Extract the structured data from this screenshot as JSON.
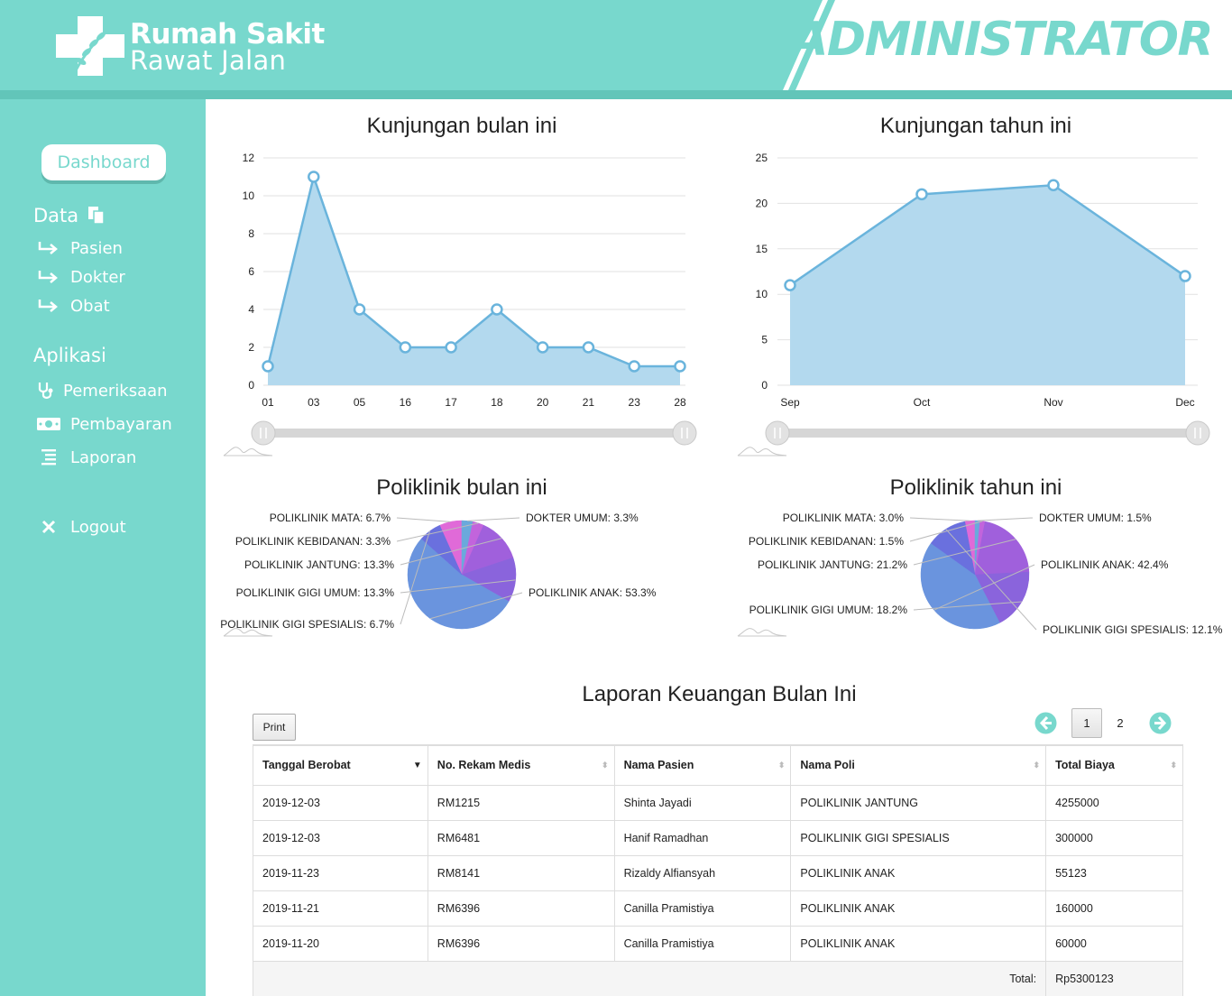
{
  "header": {
    "brand_line1": "Rumah Sakit",
    "brand_line2": "Rawat Jalan",
    "role_title": "ADMINISTRATOR",
    "colors": {
      "primary": "#78d8cd",
      "strip": "#62c5b9"
    }
  },
  "sidebar": {
    "dashboard_label": "Dashboard",
    "data_heading": "Data",
    "data_items": [
      {
        "label": "Pasien",
        "icon": "arrow-return-icon"
      },
      {
        "label": "Dokter",
        "icon": "arrow-return-icon"
      },
      {
        "label": "Obat",
        "icon": "arrow-return-icon"
      }
    ],
    "app_heading": "Aplikasi",
    "app_items": [
      {
        "label": "Pemeriksaan",
        "icon": "stethoscope-icon"
      },
      {
        "label": "Pembayaran",
        "icon": "money-icon"
      },
      {
        "label": "Laporan",
        "icon": "list-icon"
      }
    ],
    "logout_label": "Logout"
  },
  "charts": {
    "month_title": "Kunjungan bulan ini",
    "year_title": "Kunjungan tahun ini",
    "poli_month_title": "Poliklinik bulan ini",
    "poli_year_title": "Poliklinik tahun ini"
  },
  "chart_data": [
    {
      "type": "area",
      "title": "Kunjungan bulan ini",
      "x": [
        "01",
        "03",
        "05",
        "16",
        "17",
        "18",
        "20",
        "21",
        "23",
        "28"
      ],
      "values": [
        1,
        11,
        4,
        2,
        2,
        4,
        2,
        2,
        1,
        1
      ],
      "yticks": [
        "0",
        "2",
        "4",
        "6",
        "8",
        "10",
        "12"
      ],
      "ylim": [
        0,
        12
      ],
      "color": "#6ab4dc",
      "fill": "#b3d9ee"
    },
    {
      "type": "area",
      "title": "Kunjungan tahun ini",
      "x": [
        "Sep",
        "Oct",
        "Nov",
        "Dec"
      ],
      "values": [
        11,
        21,
        22,
        12
      ],
      "yticks": [
        "0",
        "5",
        "10",
        "15",
        "20",
        "25"
      ],
      "ylim": [
        0,
        25
      ],
      "color": "#6ab4dc",
      "fill": "#b3d9ee"
    },
    {
      "type": "pie",
      "title": "Poliklinik bulan ini",
      "slices": [
        {
          "label": "POLIKLINIK MATA: 6.7%",
          "value": 6.7,
          "color": "#e06ad8"
        },
        {
          "label": "DOKTER UMUM: 3.3%",
          "value": 3.3,
          "color": "#6aa9dc"
        },
        {
          "label": "POLIKLINIK KEBIDANAN: 3.3%",
          "value": 3.3,
          "color": "#c264dc"
        },
        {
          "label": "POLIKLINIK JANTUNG: 13.3%",
          "value": 13.3,
          "color": "#a060dc"
        },
        {
          "label": "POLIKLINIK GIGI UMUM: 13.3%",
          "value": 13.3,
          "color": "#8a64dc"
        },
        {
          "label": "POLIKLINIK ANAK: 53.3%",
          "value": 53.3,
          "color": "#6a94de"
        },
        {
          "label": "POLIKLINIK GIGI SPESIALIS: 6.7%",
          "value": 6.7,
          "color": "#6a70de"
        }
      ]
    },
    {
      "type": "pie",
      "title": "Poliklinik tahun ini",
      "slices": [
        {
          "label": "POLIKLINIK MATA: 3.0%",
          "value": 3.0,
          "color": "#e06ad8"
        },
        {
          "label": "DOKTER UMUM: 1.5%",
          "value": 1.5,
          "color": "#6aa9dc"
        },
        {
          "label": "POLIKLINIK KEBIDANAN: 1.5%",
          "value": 1.5,
          "color": "#c264dc"
        },
        {
          "label": "POLIKLINIK JANTUNG: 21.2%",
          "value": 21.2,
          "color": "#a060dc"
        },
        {
          "label": "POLIKLINIK GIGI UMUM: 18.2%",
          "value": 18.2,
          "color": "#8a64dc"
        },
        {
          "label": "POLIKLINIK ANAK: 42.4%",
          "value": 42.4,
          "color": "#6a94de"
        },
        {
          "label": "POLIKLINIK GIGI SPESIALIS: 12.1%",
          "value": 12.1,
          "color": "#6a70de"
        }
      ]
    }
  ],
  "report": {
    "title": "Laporan Keuangan Bulan Ini",
    "print_label": "Print",
    "page1": "1",
    "page2": "2",
    "columns": [
      "Tanggal Berobat",
      "No. Rekam Medis",
      "Nama Pasien",
      "Nama Poli",
      "Total Biaya"
    ],
    "rows": [
      [
        "2019-12-03",
        "RM1215",
        "Shinta Jayadi",
        "POLIKLINIK JANTUNG",
        "4255000"
      ],
      [
        "2019-12-03",
        "RM6481",
        "Hanif Ramadhan",
        "POLIKLINIK GIGI SPESIALIS",
        "300000"
      ],
      [
        "2019-11-23",
        "RM8141",
        "Rizaldy Alfiansyah",
        "POLIKLINIK ANAK",
        "55123"
      ],
      [
        "2019-11-21",
        "RM6396",
        "Canilla Pramistiya",
        "POLIKLINIK ANAK",
        "160000"
      ],
      [
        "2019-11-20",
        "RM6396",
        "Canilla Pramistiya",
        "POLIKLINIK ANAK",
        "60000"
      ]
    ],
    "total_label": "Total:",
    "total_value": "Rp5300123"
  }
}
